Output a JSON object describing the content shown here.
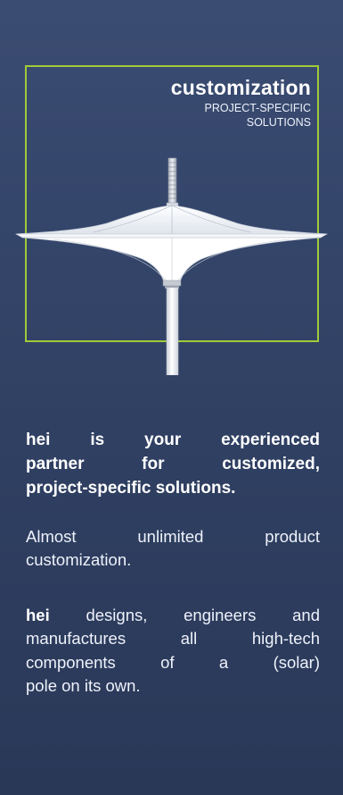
{
  "hero": {
    "title": "customization",
    "subtitle_line1": "PROJECT-SPECIFIC",
    "subtitle_line2": "SOLUTIONS"
  },
  "intro": {
    "line1": "hei is your experienced",
    "line2": "partner for customized,",
    "line3": "project-specific solutions."
  },
  "paragraph2": {
    "line1": "Almost unlimited product",
    "line2": "customization."
  },
  "paragraph3": {
    "brand": "hei",
    "line1_rest": " designs, engineers and",
    "line2": "manufactures all high-tech",
    "line3": "components of a (solar)",
    "line4": "pole on its own."
  },
  "colors": {
    "background_top": "#3b4c72",
    "background_bottom": "#2a3858",
    "frame_accent": "#9fca3a",
    "text": "#ffffff"
  },
  "illustration": {
    "icon": "solar-umbrella-pole-icon"
  }
}
